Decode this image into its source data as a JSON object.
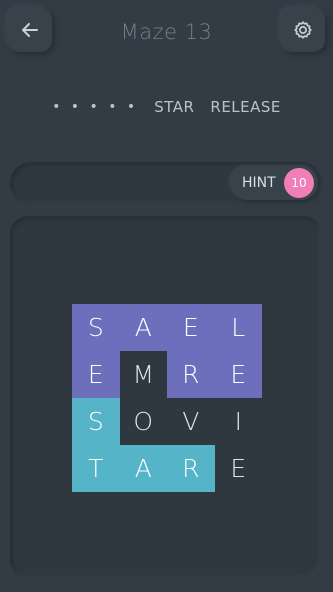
{
  "header": {
    "title": "Maze 13",
    "back_icon": "arrow-left-icon",
    "settings_icon": "gear-icon"
  },
  "words": {
    "dots": "• • • • •",
    "found": [
      "STAR",
      "RELEASE"
    ]
  },
  "hint": {
    "label": "HINT",
    "count": "10",
    "badge_color": "#ef7fb6"
  },
  "colors": {
    "purple": "#6d6fbd",
    "teal": "#55b4c8",
    "cell_empty": "#2f373f"
  },
  "grid": {
    "rows": [
      [
        {
          "letter": "S",
          "color": "purple"
        },
        {
          "letter": "A",
          "color": "purple"
        },
        {
          "letter": "E",
          "color": "purple"
        },
        {
          "letter": "L",
          "color": "purple"
        }
      ],
      [
        {
          "letter": "E",
          "color": "purple"
        },
        {
          "letter": "M",
          "color": "empty"
        },
        {
          "letter": "R",
          "color": "purple"
        },
        {
          "letter": "E",
          "color": "purple"
        }
      ],
      [
        {
          "letter": "S",
          "color": "teal"
        },
        {
          "letter": "O",
          "color": "empty"
        },
        {
          "letter": "V",
          "color": "empty"
        },
        {
          "letter": "I",
          "color": "empty"
        }
      ],
      [
        {
          "letter": "T",
          "color": "teal"
        },
        {
          "letter": "A",
          "color": "teal"
        },
        {
          "letter": "R",
          "color": "teal"
        },
        {
          "letter": "E",
          "color": "empty"
        }
      ]
    ]
  }
}
